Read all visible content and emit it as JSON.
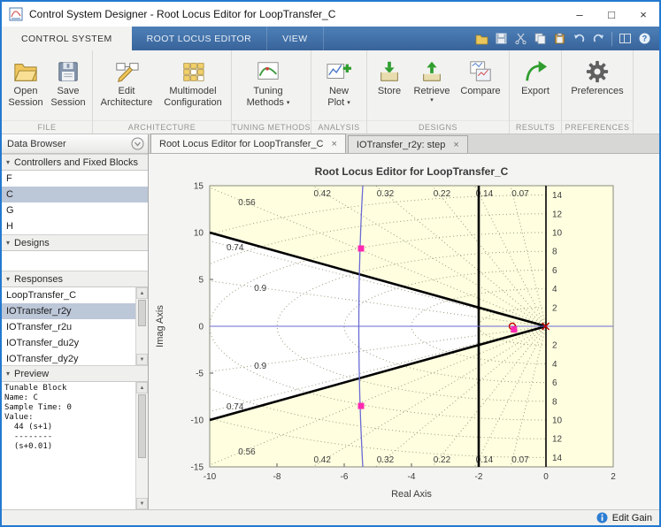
{
  "window": {
    "title": "Control System Designer - Root Locus Editor for LoopTransfer_C",
    "controls": {
      "minimize": "–",
      "maximize": "□",
      "close": "×"
    }
  },
  "toolstrip": {
    "tabs": [
      {
        "label": "CONTROL SYSTEM",
        "active": true
      },
      {
        "label": "ROOT LOCUS EDITOR",
        "active": false
      },
      {
        "label": "VIEW",
        "active": false
      }
    ],
    "quick_access_icons": [
      "open",
      "save",
      "cut",
      "copy",
      "paste",
      "undo",
      "redo",
      "layout",
      "help"
    ]
  },
  "ribbon": {
    "sections": [
      {
        "label": "FILE",
        "buttons": [
          {
            "icon": "open-folder",
            "line1": "Open",
            "line2": "Session"
          },
          {
            "icon": "save-disk",
            "line1": "Save",
            "line2": "Session"
          }
        ]
      },
      {
        "label": "ARCHITECTURE",
        "buttons": [
          {
            "icon": "edit-architecture",
            "line1": "Edit",
            "line2": "Architecture"
          },
          {
            "icon": "multimodel-grid",
            "line1": "Multimodel",
            "line2": "Configuration"
          }
        ]
      },
      {
        "label": "TUNING METHODS",
        "buttons": [
          {
            "icon": "tuning-chart",
            "line1": "Tuning",
            "line2": "Methods",
            "dropdown": true
          }
        ]
      },
      {
        "label": "ANALYSIS",
        "buttons": [
          {
            "icon": "new-plot-chart",
            "line1": "New",
            "line2": "Plot",
            "dropdown": true
          }
        ]
      },
      {
        "label": "DESIGNS",
        "buttons": [
          {
            "icon": "store-box",
            "line1": "Store"
          },
          {
            "icon": "retrieve-box",
            "line1": "Retrieve",
            "dropdown": true
          },
          {
            "icon": "compare-windows",
            "line1": "Compare"
          }
        ]
      },
      {
        "label": "RESULTS",
        "buttons": [
          {
            "icon": "export-arrow",
            "line1": "Export"
          }
        ]
      },
      {
        "label": "PREFERENCES",
        "buttons": [
          {
            "icon": "gear",
            "line1": "Preferences"
          }
        ]
      }
    ]
  },
  "browser": {
    "title": "Data Browser",
    "sections": {
      "blocks": {
        "label": "Controllers and Fixed Blocks",
        "items": [
          "F",
          "C",
          "G",
          "H"
        ],
        "selected": "C"
      },
      "designs": {
        "label": "Designs",
        "items": []
      },
      "responses": {
        "label": "Responses",
        "items": [
          "LoopTransfer_C",
          "IOTransfer_r2y",
          "IOTransfer_r2u",
          "IOTransfer_du2y",
          "IOTransfer_dy2y"
        ],
        "selected": "IOTransfer_r2y"
      },
      "preview": {
        "label": "Preview",
        "lines": [
          "Tunable Block",
          "Name: C",
          "Sample Time: 0",
          "Value:",
          "  44 (s+1)",
          "  --------",
          "  (s+0.01)"
        ]
      }
    }
  },
  "document_tabs": [
    {
      "label": "Root Locus Editor for LoopTransfer_C",
      "active": true
    },
    {
      "label": "IOTransfer_r2y: step",
      "active": false
    }
  ],
  "status": {
    "right": "Edit Gain"
  },
  "chart_data": {
    "type": "line",
    "title": "Root Locus Editor for LoopTransfer_C",
    "xlabel": "Real Axis",
    "ylabel": "Imag Axis",
    "xlim": [
      -10,
      2
    ],
    "ylim": [
      -15,
      15
    ],
    "xticks": [
      -10,
      -8,
      -6,
      -4,
      -2,
      0,
      2
    ],
    "yticks": [
      -15,
      -10,
      -5,
      0,
      5,
      10,
      15
    ],
    "grid": {
      "damping_rays": [
        0.07,
        0.14,
        0.22,
        0.32,
        0.42,
        0.56,
        0.74,
        0.9
      ],
      "frequency_circles": [
        2,
        4,
        6,
        8,
        10,
        12,
        14
      ]
    },
    "constraints": {
      "damping_cone_slope": 1.0,
      "real_axis_bound": -2
    },
    "locus_branches": [
      {
        "x": -5.5,
        "from_y": -15,
        "to_y": 15
      },
      {
        "y": 0,
        "from_x": -10,
        "to_x": 2
      }
    ],
    "closed_loop_poles": [
      [
        -5.5,
        8.3
      ],
      [
        -5.5,
        -8.5
      ],
      [
        -0.95,
        -0.35
      ]
    ],
    "open_loop_poles": [
      [
        -0.01,
        0
      ]
    ],
    "open_loop_zeros": [
      [
        -1,
        0
      ]
    ],
    "colors": {
      "background": "#ffffe0",
      "allowed_region": "#ffffff",
      "locus": "#6a6ad4",
      "constraint": "#000000",
      "closed_loop_pole": "#ff29b0",
      "open_loop": "#c00000"
    }
  }
}
